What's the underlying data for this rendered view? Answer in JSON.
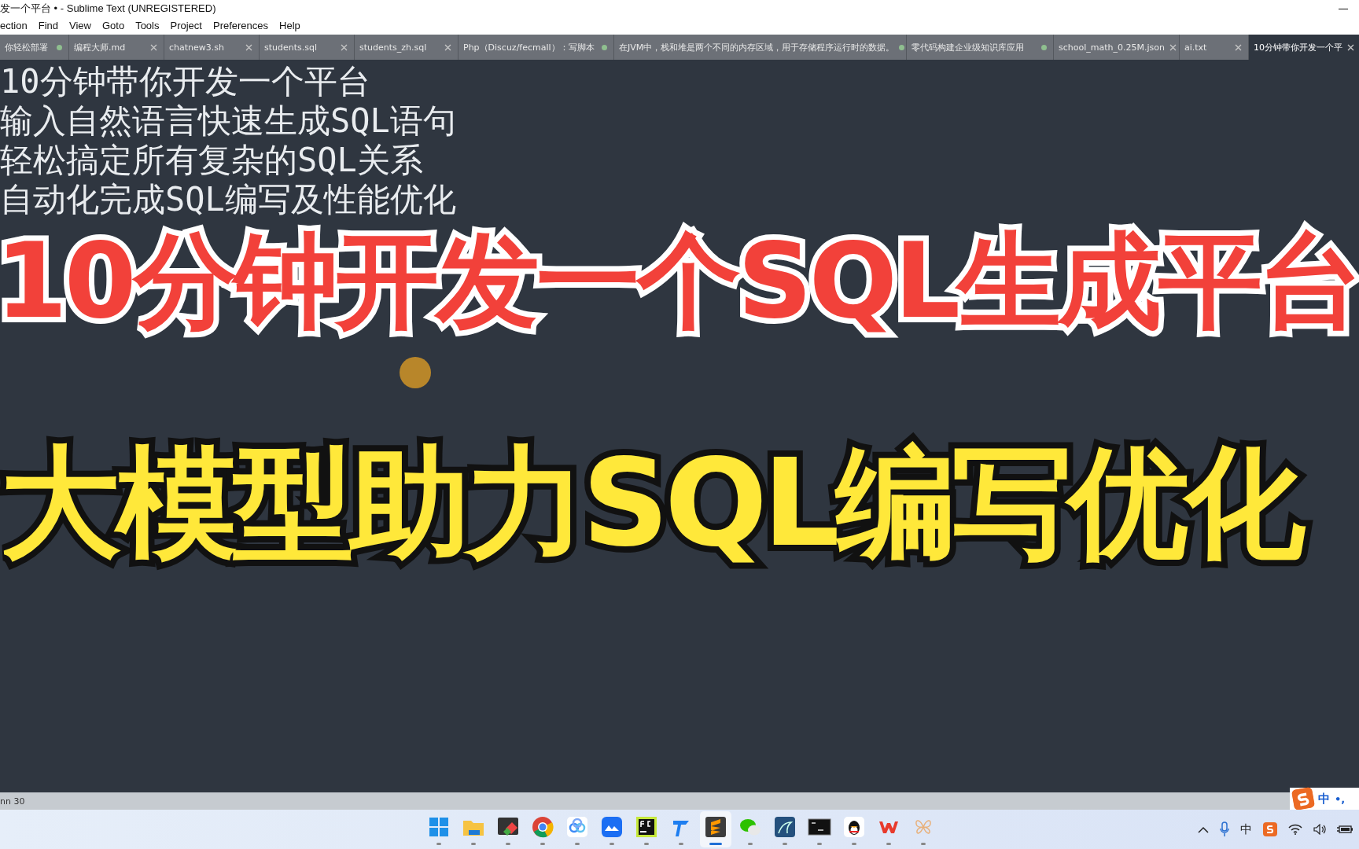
{
  "window": {
    "title": "发一个平台 • - Sublime Text (UNREGISTERED)"
  },
  "menu": [
    "ection",
    "Find",
    "View",
    "Goto",
    "Tools",
    "Project",
    "Preferences",
    "Help"
  ],
  "tabs": [
    {
      "label": "你轻松部署",
      "modified": true,
      "selected": false
    },
    {
      "label": "编程大师.md",
      "modified": false,
      "selected": false
    },
    {
      "label": "chatnew3.sh",
      "modified": false,
      "selected": false
    },
    {
      "label": "students.sql",
      "modified": false,
      "selected": false
    },
    {
      "label": "students_zh.sql",
      "modified": false,
      "selected": false
    },
    {
      "label": "Php（Discuz/fecmall）：写脚本",
      "modified": true,
      "selected": false
    },
    {
      "label": "在JVM中，栈和堆是两个不同的内存区域，用于存储程序运行时的数据。",
      "modified": true,
      "selected": false
    },
    {
      "label": "零代码构建企业级知识库应用",
      "modified": true,
      "selected": false
    },
    {
      "label": "school_math_0.25M.json",
      "modified": false,
      "selected": false
    },
    {
      "label": "ai.txt",
      "modified": false,
      "selected": false
    },
    {
      "label": "10分钟带你开发一个平",
      "modified": false,
      "selected": true
    }
  ],
  "editor": {
    "lines": [
      "10分钟带你开发一个平台",
      "输入自然语言快速生成SQL语句",
      "轻松搞定所有复杂的SQL关系",
      "自动化完成SQL编写及性能优化"
    ]
  },
  "overlay": {
    "headline": "10分钟开发一个SQL生成平台",
    "subheadline": "大模型助力SQL编写优化"
  },
  "status_bar": {
    "position": "nn 30"
  },
  "ime_bar": {
    "mode": "中",
    "punctuation": "•,"
  },
  "taskbar": {
    "apps": [
      {
        "kind": "start",
        "selected": false
      },
      {
        "kind": "folder",
        "selected": false
      },
      {
        "kind": "terminal-tiles",
        "selected": false
      },
      {
        "kind": "browser",
        "selected": false
      },
      {
        "kind": "cloud",
        "selected": false
      },
      {
        "kind": "mountains",
        "selected": false
      },
      {
        "kind": "pycharm",
        "selected": false
      },
      {
        "kind": "pin",
        "selected": false
      },
      {
        "kind": "sublime",
        "selected": true
      },
      {
        "kind": "chat",
        "selected": false
      },
      {
        "kind": "dolphin",
        "selected": false
      },
      {
        "kind": "console",
        "selected": false
      },
      {
        "kind": "penguin",
        "selected": false
      },
      {
        "kind": "office",
        "selected": false
      },
      {
        "kind": "butterfly",
        "selected": false
      }
    ]
  },
  "tray": {
    "input_mode": "中"
  }
}
